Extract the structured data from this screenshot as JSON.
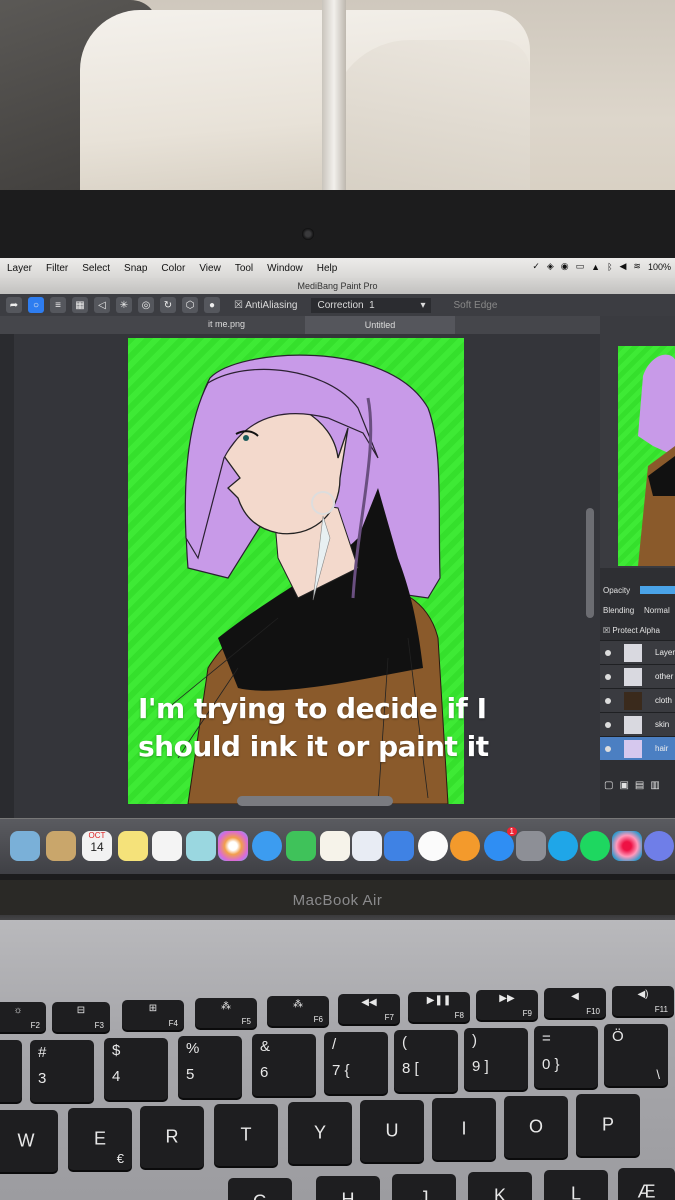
{
  "menubar": {
    "items": [
      "Layer",
      "Filter",
      "Select",
      "Snap",
      "Color",
      "View",
      "Tool",
      "Window",
      "Help"
    ],
    "battery": "100%"
  },
  "window": {
    "title": "MediBang Paint Pro"
  },
  "toolbar": {
    "antialiasing_label": "AntiAliasing",
    "correction_label": "Correction",
    "correction_value": "1",
    "soft_edge_label": "Soft Edge"
  },
  "tabs": [
    {
      "label": "it me.png"
    },
    {
      "label": "Untitled"
    }
  ],
  "layers_panel": {
    "opacity_label": "Opacity",
    "blending_label": "Blending",
    "blending_value": "Normal",
    "protect_alpha_label": "Protect Alpha",
    "layers": [
      {
        "name": "Layer",
        "selected": false
      },
      {
        "name": "other",
        "selected": false
      },
      {
        "name": "cloth",
        "selected": false
      },
      {
        "name": "skin",
        "selected": false
      },
      {
        "name": "hair",
        "selected": true
      }
    ]
  },
  "caption": {
    "line1": "I'm trying to decide if I",
    "line2": "should ink it or paint it"
  },
  "laptop": {
    "brand": "MacBook Air"
  },
  "dock": {
    "calendar_month": "OCT",
    "calendar_day": "14",
    "appstore_badge": "1"
  },
  "keyboard": {
    "function_keys": [
      "F2",
      "F3",
      "F4",
      "F5",
      "F6",
      "F7",
      "F8",
      "F9",
      "F10",
      "F11"
    ],
    "number_row": [
      {
        "top": "#",
        "bottom": "3"
      },
      {
        "top": "$",
        "bottom": "4"
      },
      {
        "top": "%",
        "bottom": "5"
      },
      {
        "top": "&",
        "bottom": "6"
      },
      {
        "top": "/",
        "bottom": "7 {"
      },
      {
        "top": "(",
        "bottom": "8 ["
      },
      {
        "top": ")",
        "bottom": "9 ]"
      },
      {
        "top": "=",
        "bottom": "0 }"
      },
      {
        "top": "Ö",
        "bottom": "\\"
      }
    ],
    "letter_row": [
      "W",
      "E",
      "R",
      "T",
      "Y",
      "U",
      "I",
      "O",
      "P"
    ],
    "euro_symbol": "€",
    "bottom_row": [
      "G",
      "H",
      "J",
      "K",
      "L",
      "Æ"
    ]
  },
  "colors": {
    "canvas_green": "#35e02c",
    "hair_purple": "#c89ae8",
    "cloth_brown": "#8a5a2b",
    "collar_black": "#111111",
    "skin": "#f3d9cc",
    "selection_blue": "#4b7fc2"
  }
}
